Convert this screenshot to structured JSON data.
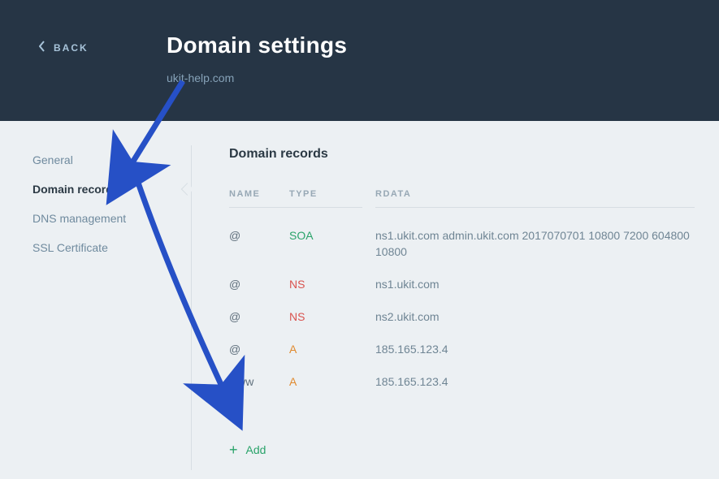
{
  "back_label": "BACK",
  "page_title": "Domain settings",
  "domain": "ukit-help.com",
  "sidebar": {
    "items": [
      {
        "label": "General"
      },
      {
        "label": "Domain records"
      },
      {
        "label": "DNS management"
      },
      {
        "label": "SSL Certificate"
      }
    ],
    "active_index": 1
  },
  "section_title": "Domain records",
  "table": {
    "headers": {
      "name": "NAME",
      "type": "TYPE",
      "rdata": "RDATA"
    },
    "rows": [
      {
        "name": "@",
        "type": "SOA",
        "rdata": "ns1.ukit.com admin.ukit.com 2017070701 10800 7200 604800 10800"
      },
      {
        "name": "@",
        "type": "NS",
        "rdata": "ns1.ukit.com"
      },
      {
        "name": "@",
        "type": "NS",
        "rdata": "ns2.ukit.com"
      },
      {
        "name": "@",
        "type": "A",
        "rdata": "185.165.123.4"
      },
      {
        "name": "www",
        "type": "A",
        "rdata": "185.165.123.4"
      }
    ]
  },
  "add_label": "Add",
  "colors": {
    "header_bg": "#263545",
    "accent_green": "#2aa36a",
    "ns_red": "#d9534f",
    "a_orange": "#e08a2e",
    "arrow_blue": "#2650c6"
  }
}
